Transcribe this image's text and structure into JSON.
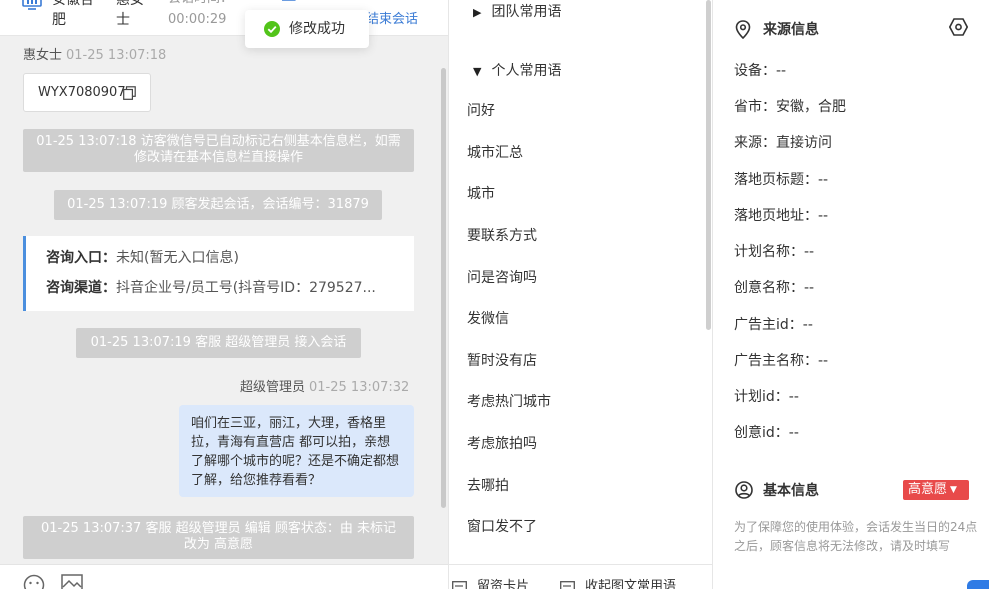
{
  "header": {
    "location": "安徽合肥",
    "customer": "惠女士",
    "time_label": "会话时间：",
    "duration": "00:00:29",
    "end_button": "结束会话"
  },
  "toast": {
    "text": "修改成功"
  },
  "messages": {
    "visitor_name": "惠女士",
    "visitor_time": "01-25 13:07:18",
    "wechat_id": "WYX7080907",
    "sys1": "01-25 13:07:18 访客微信号已自动标记右侧基本信息栏，如需修改请在基本信息栏直接操作",
    "sys2": "01-25 13:07:19 顾客发起会话，会话编号：31879",
    "entry_label": "咨询入口：",
    "entry_value": "未知(暂无入口信息)",
    "channel_label": "咨询渠道：",
    "channel_value": "抖音企业号/员工号(抖音号ID：279527...",
    "sys3": "01-25 13:07:19 客服 超级管理员 接入会话",
    "agent_name": "超级管理员",
    "agent_time": "01-25 13:07:32",
    "agent_msg": "咱们在三亚，丽江，大理，香格里拉，青海有直营店 都可以拍，亲想了解哪个城市的呢？还是不确定都想了解，给您推荐看看？",
    "sys4": "01-25 13:07:37 客服 超级管理员 编辑 顾客状态：由 未标记 改为 高意愿"
  },
  "phrases": {
    "team_group": "团队常用语",
    "personal_group": "个人常用语",
    "items": [
      "问好",
      "城市汇总",
      "城市",
      "要联系方式",
      "问是咨询吗",
      "发微信",
      "暂时没有店",
      "考虑热门城市",
      "考虑旅拍吗",
      "去哪拍",
      "窗口发不了"
    ],
    "footer_card": "留资卡片",
    "footer_collapse": "收起图文常用语"
  },
  "source_info": {
    "title": "来源信息",
    "rows": [
      "设备：--",
      "省市：安徽，合肥",
      "来源：直接访问",
      "落地页标题：--",
      "落地页地址：--",
      "计划名称：--",
      "创意名称：--",
      "广告主id：--",
      "广告主名称：--",
      "计划id：--",
      "创意id：--"
    ]
  },
  "basic_info": {
    "title": "基本信息",
    "intent_badge": "高意愿",
    "hint": "为了保障您的使用体验，会话发生当日的24点之后，顾客信息将无法修改，请及时填写"
  },
  "icons": {
    "header": "monitor-icon",
    "toast": "check-circle-icon",
    "copy": "copy-icon",
    "emoji": "emoji-icon",
    "image": "image-icon",
    "location": "location-pin-icon",
    "settings": "hexagon-settings-icon",
    "user": "user-circle-icon"
  },
  "colors": {
    "accent": "#3a7bd5",
    "badge": "#e84a4a",
    "success": "#52c41a",
    "agent_bubble": "#dbe8fb"
  }
}
